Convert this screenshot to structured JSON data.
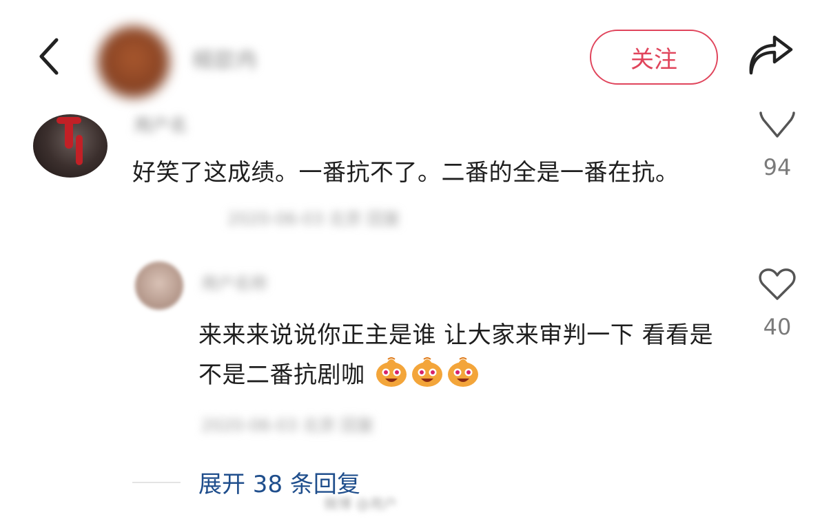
{
  "header": {
    "username": "楊歆冉",
    "follow_label": "关注",
    "icons": {
      "back": "chevron-left-icon",
      "share": "share-arrow-icon"
    }
  },
  "comment": {
    "username": "用户名",
    "text": "好笑了这成绩。一番抗不了。二番的全是一番在抗。",
    "meta": "2020-06-03 北京 回复",
    "like_count": "94"
  },
  "reply": {
    "username": "用户名称",
    "text": "来来来说说你正主是谁 让大家来审判一下 看看是不是二番抗剧咖",
    "emoji_count": 3,
    "emoji_name": "laughing-face-emoji",
    "meta": "2020-06-03 北京 回复",
    "like_count": "40"
  },
  "expand_label": "展开 38 条回复",
  "watermark": "微博 @用户",
  "colors": {
    "accent": "#e0445b",
    "link": "#1f4e8c",
    "muted": "#7a7a7a"
  }
}
